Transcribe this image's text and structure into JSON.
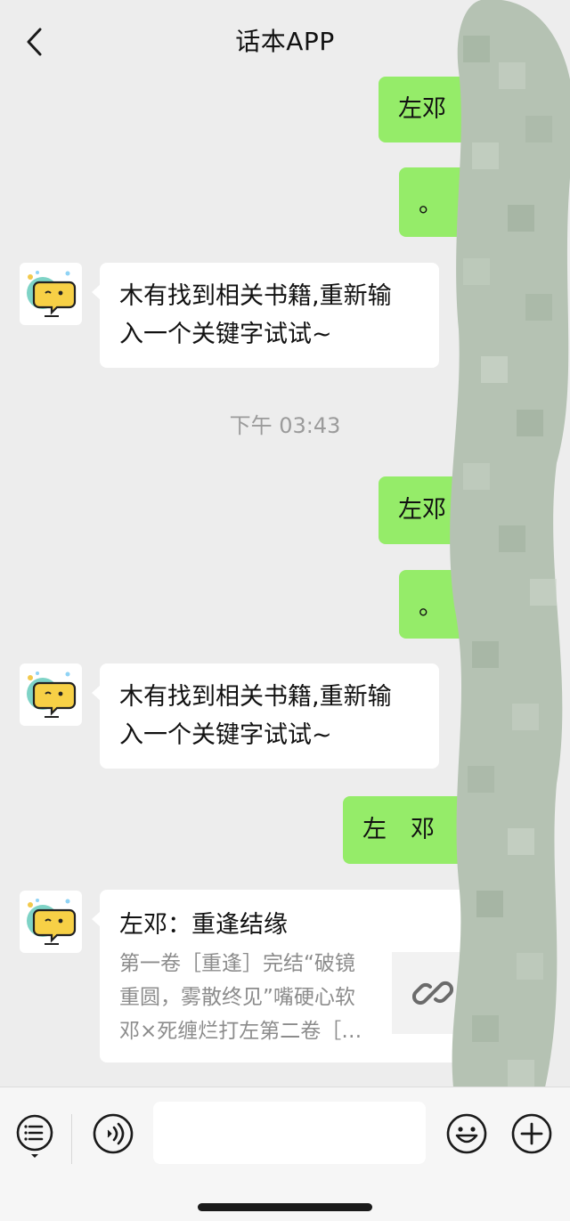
{
  "header": {
    "title": "话本APP",
    "back_icon": "chevron-left-icon"
  },
  "messages": [
    {
      "from": "me",
      "text": "左邓"
    },
    {
      "from": "me",
      "text": "。"
    },
    {
      "from": "bot",
      "line1": "木有找到相关书籍,重新输",
      "line2": "入一个关键字试试~"
    },
    {
      "time": "下午 03:43"
    },
    {
      "from": "me",
      "text": "左邓"
    },
    {
      "from": "me",
      "text": "。"
    },
    {
      "from": "bot",
      "line1": "木有找到相关书籍,重新输",
      "line2": "入一个关键字试试~"
    },
    {
      "from": "me",
      "text": "左　邓"
    },
    {
      "from": "bot",
      "card_title": "左邓：重逢结缘",
      "card_line1": "第一卷［重逢］完结“破镜",
      "card_line2": "重圆，雾散终见”嘴硬心软",
      "card_line3": "邓×死缠烂打左第二卷［…",
      "thumb_icon": "link-icon"
    }
  ],
  "bottom_bar": {
    "menu_icon": "list-menu-icon",
    "voice_icon": "voice-icon",
    "emoji_icon": "emoji-icon",
    "plus_icon": "plus-icon",
    "input_value": ""
  },
  "colors": {
    "my_bubble": "#95ec69",
    "bot_bubble": "#ffffff",
    "background": "#ededed"
  }
}
